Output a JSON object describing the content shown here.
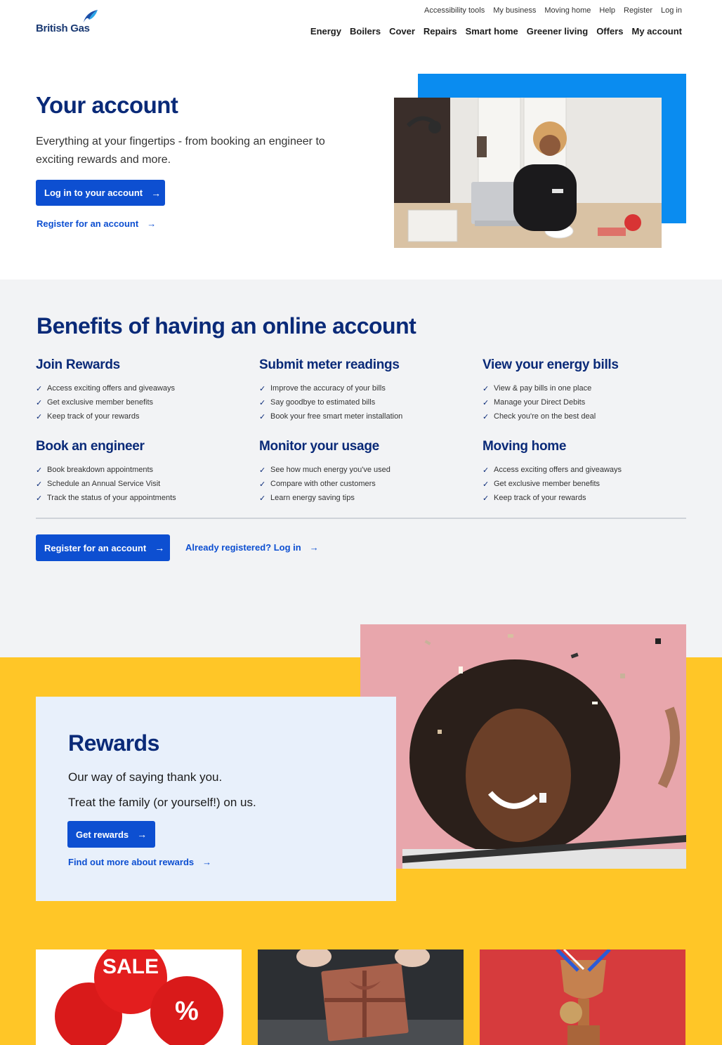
{
  "brand": {
    "name": "British Gas"
  },
  "utility_nav": [
    "Accessibility tools",
    "My business",
    "Moving home",
    "Help",
    "Register",
    "Log in"
  ],
  "main_nav": [
    "Energy",
    "Boilers",
    "Cover",
    "Repairs",
    "Smart home",
    "Greener living",
    "Offers",
    "My account"
  ],
  "hero": {
    "title": "Your account",
    "description": "Everything at your fingertips - from booking an engineer to exciting rewards and more.",
    "login_button": "Log in to your account",
    "register_link": "Register for an account"
  },
  "benefits": {
    "title": "Benefits of having an online account",
    "sections": [
      {
        "heading": "Join Rewards",
        "items": [
          "Access exciting offers and giveaways",
          "Get exclusive member benefits",
          "Keep track of your rewards"
        ]
      },
      {
        "heading": "Submit meter readings",
        "items": [
          "Improve the accuracy of your bills",
          "Say goodbye to estimated bills",
          "Book your free smart meter installation"
        ]
      },
      {
        "heading": "View your energy bills",
        "items": [
          "View & pay bills in one place",
          "Manage your Direct Debits",
          "Check you're on the best deal"
        ]
      },
      {
        "heading": "Book an engineer",
        "items": [
          "Book breakdown appointments",
          "Schedule an Annual Service Visit",
          "Track the status of your appointments"
        ]
      },
      {
        "heading": "Monitor your usage",
        "items": [
          "See how much energy you've used",
          "Compare with other customers",
          "Learn energy saving tips"
        ]
      },
      {
        "heading": "Moving home",
        "items": [
          "Access exciting offers and giveaways",
          "Get exclusive member benefits",
          "Keep track of your rewards"
        ]
      }
    ],
    "register_button": "Register for an account",
    "login_link": "Already registered? Log in"
  },
  "rewards": {
    "title": "Rewards",
    "line1": "Our way of saying thank you.",
    "line2": "Treat the family (or yourself!) on us.",
    "button": "Get rewards",
    "link": "Find out more about rewards"
  },
  "tiles": {
    "sale_text": "SALE",
    "percent_text": "%"
  },
  "icons": {
    "arrow": "→",
    "check": "✓"
  },
  "colors": {
    "brand_navy": "#0a2a78",
    "primary_blue": "#0d4fd1",
    "bright_blue": "#0a8cf0",
    "yellow": "#ffc627",
    "light_gray": "#f2f3f5",
    "card_blue": "#e8f0fb"
  }
}
